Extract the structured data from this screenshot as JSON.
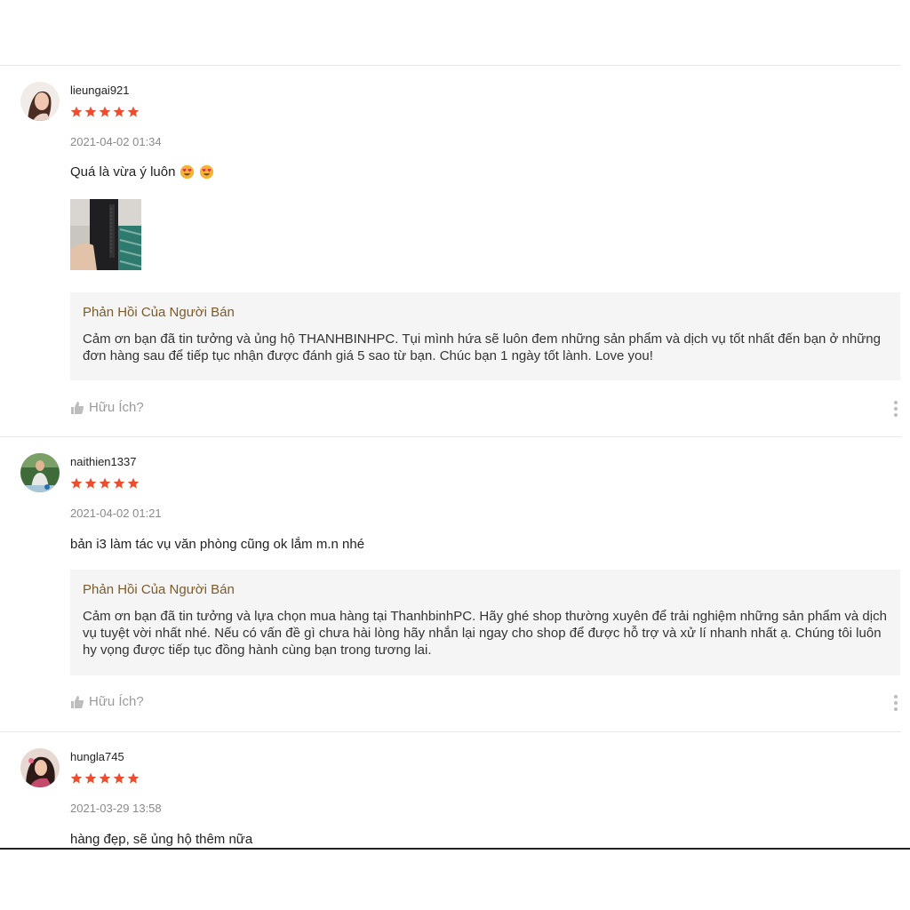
{
  "colors": {
    "star": "#ee4d2d",
    "reply_title": "#7a5b2b",
    "date": "#8a8a8a"
  },
  "reviews": [
    {
      "username": "lieungai921",
      "rating": 5,
      "date": "2021-04-02 01:34",
      "comment": "Quá là vừa ý luôn",
      "comment_emojis": [
        "heart-eyes-emoji",
        "heart-eyes-emoji"
      ],
      "has_photo": true,
      "reply_title": "Phản Hồi Của Người Bán",
      "reply_text": "Cảm ơn bạn đã tin tưởng và ủng hộ THANHBINHPC. Tụi mình hứa sẽ luôn đem những sản phẩm và dịch vụ tốt nhất đến bạn ở những đơn hàng sau để tiếp tục nhận được đánh giá 5 sao từ bạn. Chúc bạn 1 ngày tốt lành. Love you!",
      "helpful_label": "Hữu Ích?"
    },
    {
      "username": "naithien1337",
      "rating": 5,
      "date": "2021-04-02 01:21",
      "comment": "bản i3 làm tác vụ văn phòng cũng ok lắm m.n nhé",
      "reply_title": "Phản Hồi Của Người Bán",
      "reply_text": "Cảm ơn bạn đã tin tưởng và lựa chọn mua hàng tại ThanhbinhPC. Hãy ghé shop thường xuyên để trải nghiệm những sản phẩm và dịch vụ tuyệt vời nhất nhé. Nếu có vấn đề gì chưa hài lòng hãy nhắn lại ngay cho shop để được hỗ trợ và xử lí nhanh nhất ạ. Chúng tôi luôn hy vọng được tiếp tục đồng hành cùng bạn trong tương lai.",
      "helpful_label": "Hữu Ích?"
    },
    {
      "username": "hungla745",
      "rating": 5,
      "date": "2021-03-29 13:58",
      "comment": "hàng đẹp, sẽ ủng hộ thêm nữa"
    }
  ],
  "icons": {
    "star": "star-icon",
    "thumb": "thumbs-up-icon",
    "more": "more-vertical-icon"
  }
}
